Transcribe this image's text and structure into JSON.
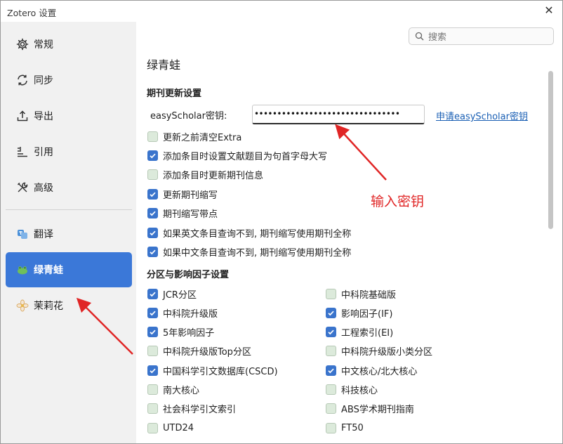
{
  "window": {
    "title": "Zotero 设置"
  },
  "search": {
    "placeholder": "搜索"
  },
  "sidebar": {
    "items": [
      {
        "label": "常规",
        "icon": "gear-icon"
      },
      {
        "label": "同步",
        "icon": "sync-icon"
      },
      {
        "label": "导出",
        "icon": "export-icon"
      },
      {
        "label": "引用",
        "icon": "cite-icon"
      },
      {
        "label": "高级",
        "icon": "tools-icon"
      },
      {
        "label": "翻译",
        "icon": "translate-icon"
      },
      {
        "label": "绿青蛙",
        "icon": "frog-icon",
        "active": true
      },
      {
        "label": "茉莉花",
        "icon": "jasmine-icon"
      }
    ]
  },
  "main": {
    "title": "绿青蛙",
    "journal_section": {
      "title": "期刊更新设置",
      "key_label": "easyScholar密钥:",
      "key_value": "••••••••••••••••••••••••••••••••",
      "key_link": "申请easyScholar密钥",
      "options": [
        {
          "label": "更新之前清空Extra",
          "checked": false
        },
        {
          "label": "添加条目时设置文献题目为句首字母大写",
          "checked": true
        },
        {
          "label": "添加条目时更新期刊信息",
          "checked": false
        },
        {
          "label": "更新期刊缩写",
          "checked": true
        },
        {
          "label": "期刊缩写带点",
          "checked": true
        },
        {
          "label": "如果英文条目查询不到, 期刊缩写使用期刊全称",
          "checked": true
        },
        {
          "label": "如果中文条目查询不到, 期刊缩写使用期刊全称",
          "checked": true
        }
      ]
    },
    "impact_section": {
      "title": "分区与影响因子设置",
      "left": [
        {
          "label": "JCR分区",
          "checked": true
        },
        {
          "label": "中科院升级版",
          "checked": true
        },
        {
          "label": "5年影响因子",
          "checked": true
        },
        {
          "label": "中科院升级版Top分区",
          "checked": false
        },
        {
          "label": "中国科学引文数据库(CSCD)",
          "checked": true
        },
        {
          "label": "南大核心",
          "checked": false
        },
        {
          "label": "社会科学引文索引",
          "checked": false
        },
        {
          "label": "UTD24",
          "checked": false
        }
      ],
      "right": [
        {
          "label": "中科院基础版",
          "checked": false
        },
        {
          "label": "影响因子(IF)",
          "checked": true
        },
        {
          "label": "工程索引(EI)",
          "checked": true
        },
        {
          "label": "中科院升级版小类分区",
          "checked": false
        },
        {
          "label": "中文核心/北大核心",
          "checked": true
        },
        {
          "label": "科技核心",
          "checked": false
        },
        {
          "label": "ABS学术期刊指南",
          "checked": false
        },
        {
          "label": "FT50",
          "checked": false
        }
      ]
    }
  },
  "annotation": {
    "text": "输入密钥",
    "color": "#e02525"
  },
  "colors": {
    "accent": "#3b78d8",
    "checkbox_on": "#3a74cc",
    "checkbox_off": "#dceadb",
    "link": "#1a5fb4"
  }
}
